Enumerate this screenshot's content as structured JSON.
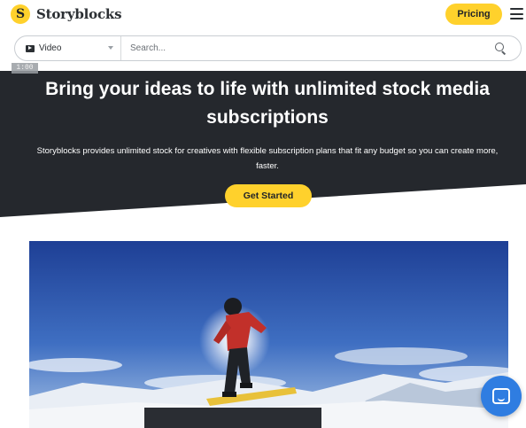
{
  "header": {
    "logo_mark": "S",
    "brand": "Storyblocks",
    "pricing_label": "Pricing",
    "menu_icon": "hamburger-icon"
  },
  "search": {
    "media_type": "Video",
    "media_icon": "video-icon",
    "placeholder": "Search...",
    "submit_icon": "search-icon"
  },
  "hero": {
    "timer": "1:00",
    "title": "Bring your ideas to life with unlimited stock media subscriptions",
    "subtitle": "Storyblocks provides unlimited stock for creatives with flexible subscription plans that fit any budget so you can create more, faster.",
    "cta_label": "Get Started",
    "background_color": "#25282d"
  },
  "media": {
    "icon": "snowboarder-image"
  },
  "chat": {
    "icon": "chat-icon",
    "color": "#2f7de1"
  },
  "colors": {
    "accent": "#ffd12c",
    "dark": "#25282d"
  }
}
